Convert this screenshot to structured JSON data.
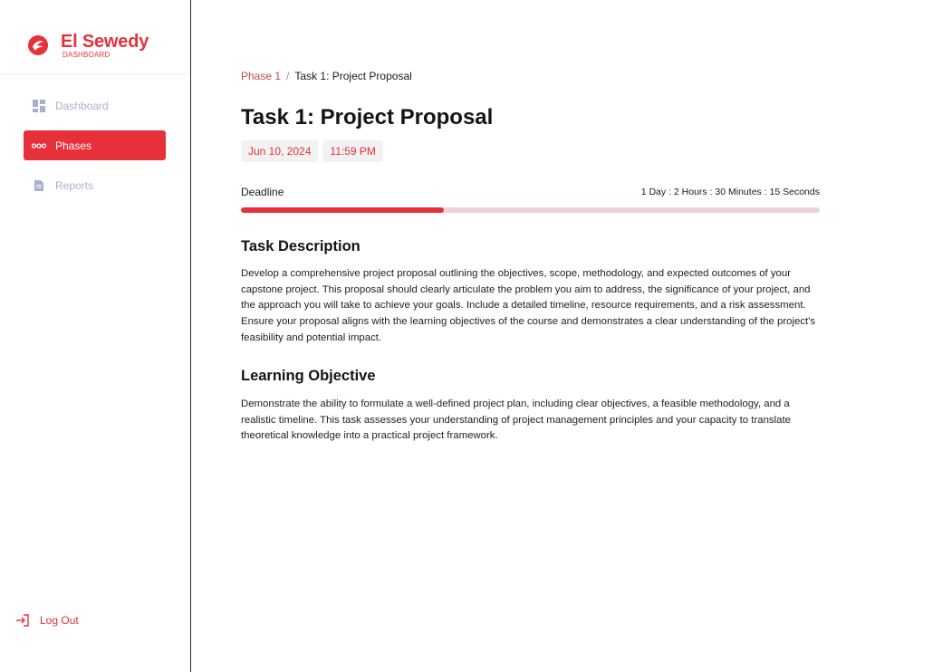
{
  "brand": {
    "name": "El Sewedy",
    "subtitle": "DASHBOARD",
    "logo_icon": "el-sewedy-logo",
    "accent_color": "#e8303a"
  },
  "sidebar": {
    "items": [
      {
        "label": "Dashboard",
        "icon": "dashboard-grid-icon",
        "active": false
      },
      {
        "label": "Phases",
        "icon": "phases-dots-icon",
        "active": true
      },
      {
        "label": "Reports",
        "icon": "reports-document-icon",
        "active": false
      }
    ],
    "logout": {
      "label": "Log Out",
      "icon": "logout-icon"
    }
  },
  "breadcrumb": {
    "parent": "Phase 1",
    "separator": "/",
    "current": "Task 1: Project Proposal"
  },
  "task": {
    "title": "Task 1: Project Proposal",
    "date": "Jun 10, 2024",
    "time": "11:59 PM",
    "deadline_label": "Deadline",
    "countdown": "1 Day : 2 Hours : 30 Minutes : 15 Seconds",
    "progress_percent": 35,
    "description_title": "Task Description",
    "description": "Develop a comprehensive project proposal outlining the objectives, scope, methodology, and expected outcomes of your capstone project. This proposal should clearly articulate the problem you aim to address, the significance of your project, and the approach you will take to achieve your goals. Include a detailed timeline, resource requirements, and a risk assessment. Ensure your proposal aligns with the learning objectives of the course and demonstrates a clear understanding of the project's feasibility and potential impact.",
    "objective_title": "Learning Objective",
    "objective": "Demonstrate the ability to formulate a well-defined project plan, including clear objectives, a feasible methodology, and a realistic timeline. This task assesses your understanding of project management principles and your capacity to translate theoretical knowledge into a practical project framework."
  }
}
